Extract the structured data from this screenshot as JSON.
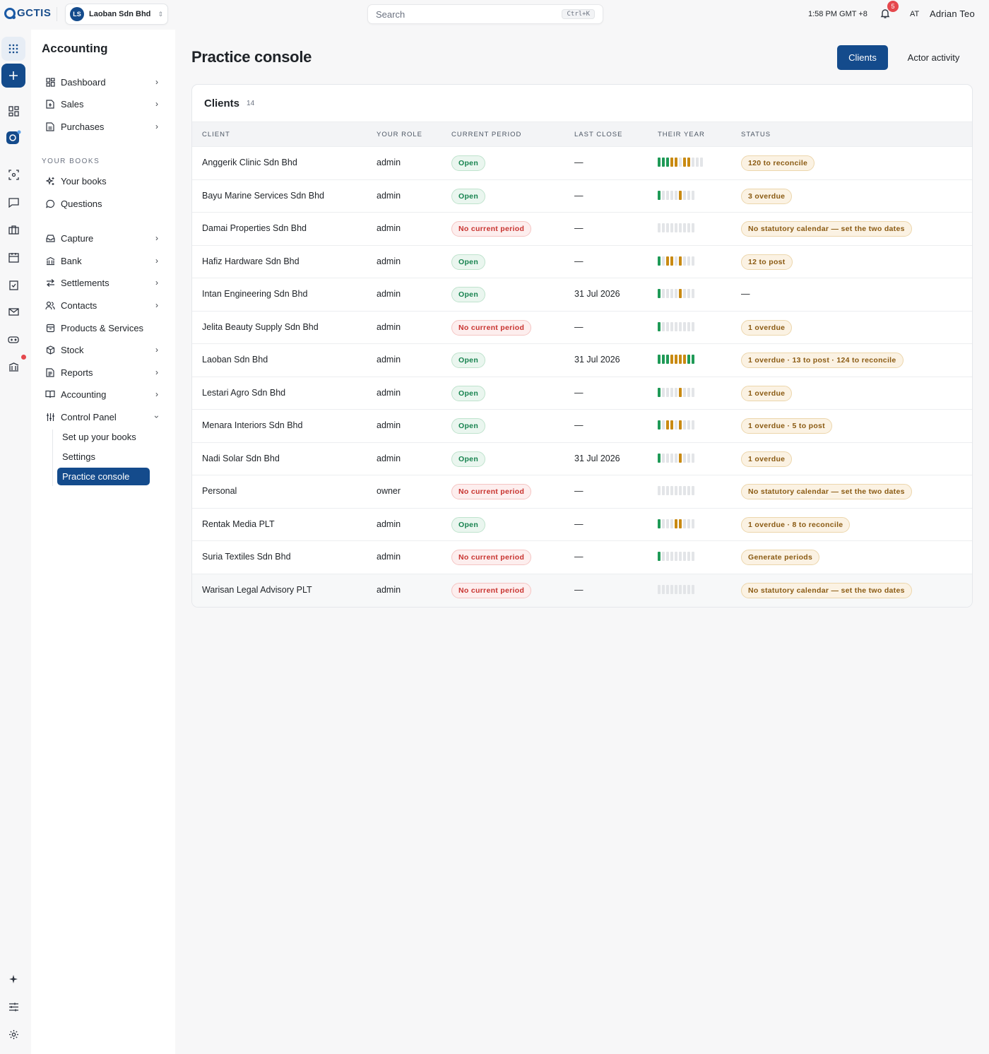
{
  "topbar": {
    "logo_text": "GCTIS",
    "org": {
      "initials": "LS",
      "name": "Laoban Sdn Bhd"
    },
    "search": {
      "placeholder": "Search",
      "shortcut": "Ctrl+K"
    },
    "clock": "1:58 PM GMT +8",
    "notifications": "5",
    "user_initials": "AT",
    "user_name": "Adrian Teo"
  },
  "sidebar": {
    "title": "Accounting",
    "top_items": [
      {
        "label": "Dashboard",
        "icon": "dashboard-icon"
      },
      {
        "label": "Sales",
        "icon": "sales-icon"
      },
      {
        "label": "Purchases",
        "icon": "purchases-icon"
      }
    ],
    "section_label": "YOUR BOOKS",
    "book_items": [
      {
        "label": "Your books",
        "icon": "sparkles-icon"
      },
      {
        "label": "Questions",
        "icon": "chat-icon"
      }
    ],
    "main_items": [
      {
        "label": "Capture",
        "icon": "inbox-icon"
      },
      {
        "label": "Bank",
        "icon": "bank-icon"
      },
      {
        "label": "Settlements",
        "icon": "arrows-icon"
      },
      {
        "label": "Contacts",
        "icon": "contacts-icon"
      },
      {
        "label": "Products & Services",
        "icon": "products-icon"
      },
      {
        "label": "Stock",
        "icon": "box-icon"
      },
      {
        "label": "Reports",
        "icon": "reports-icon"
      },
      {
        "label": "Accounting",
        "icon": "book-icon"
      },
      {
        "label": "Control Panel",
        "icon": "sliders-icon"
      }
    ],
    "control_panel_sub": [
      "Set up your books",
      "Settings",
      "Practice console"
    ]
  },
  "main": {
    "title": "Practice console",
    "tabs": [
      "Clients",
      "Actor activity"
    ],
    "card_title": "Clients",
    "card_count": "14",
    "columns": [
      "CLIENT",
      "YOUR ROLE",
      "CURRENT PERIOD",
      "LAST CLOSE",
      "THEIR YEAR",
      "STATUS"
    ],
    "rows": [
      {
        "client": "Anggerik Clinic Sdn Bhd",
        "role": "admin",
        "period": "Open",
        "last_close": "—",
        "year": "gggaa-aa---",
        "status": "120 to reconcile"
      },
      {
        "client": "Bayu Marine Services Sdn Bhd",
        "role": "admin",
        "period": "Open",
        "last_close": "—",
        "year": "g----a---",
        "status": "3 overdue"
      },
      {
        "client": "Damai Properties Sdn Bhd",
        "role": "admin",
        "period": "No current period",
        "last_close": "—",
        "year": "---------",
        "status": "No statutory calendar — set the two dates"
      },
      {
        "client": "Hafiz Hardware Sdn Bhd",
        "role": "admin",
        "period": "Open",
        "last_close": "—",
        "year": "g-aa-a---",
        "status": "12 to post"
      },
      {
        "client": "Intan Engineering Sdn Bhd",
        "role": "admin",
        "period": "Open",
        "last_close": "31 Jul 2026",
        "year": "g----a---",
        "status": "—"
      },
      {
        "client": "Jelita Beauty Supply Sdn Bhd",
        "role": "admin",
        "period": "No current period",
        "last_close": "—",
        "year": "g--------",
        "status": "1 overdue"
      },
      {
        "client": "Laoban Sdn Bhd",
        "role": "admin",
        "period": "Open",
        "last_close": "31 Jul 2026",
        "year": "gggaaaagg",
        "status": "1 overdue · 13 to post · 124 to reconcile"
      },
      {
        "client": "Lestari Agro Sdn Bhd",
        "role": "admin",
        "period": "Open",
        "last_close": "—",
        "year": "g----a---",
        "status": "1 overdue"
      },
      {
        "client": "Menara Interiors Sdn Bhd",
        "role": "admin",
        "period": "Open",
        "last_close": "—",
        "year": "g-aa-a---",
        "status": "1 overdue · 5 to post"
      },
      {
        "client": "Nadi Solar Sdn Bhd",
        "role": "admin",
        "period": "Open",
        "last_close": "31 Jul 2026",
        "year": "g----a---",
        "status": "1 overdue"
      },
      {
        "client": "Personal",
        "role": "owner",
        "period": "No current period",
        "last_close": "—",
        "year": "---------",
        "status": "No statutory calendar — set the two dates"
      },
      {
        "client": "Rentak Media PLT",
        "role": "admin",
        "period": "Open",
        "last_close": "—",
        "year": "g---aa---",
        "status": "1 overdue · 8 to reconcile"
      },
      {
        "client": "Suria Textiles Sdn Bhd",
        "role": "admin",
        "period": "No current period",
        "last_close": "—",
        "year": "g--------",
        "status": "Generate periods"
      },
      {
        "client": "Warisan Legal Advisory PLT",
        "role": "admin",
        "period": "No current period",
        "last_close": "—",
        "year": "---------",
        "status": "No statutory calendar — set the two dates"
      }
    ]
  }
}
